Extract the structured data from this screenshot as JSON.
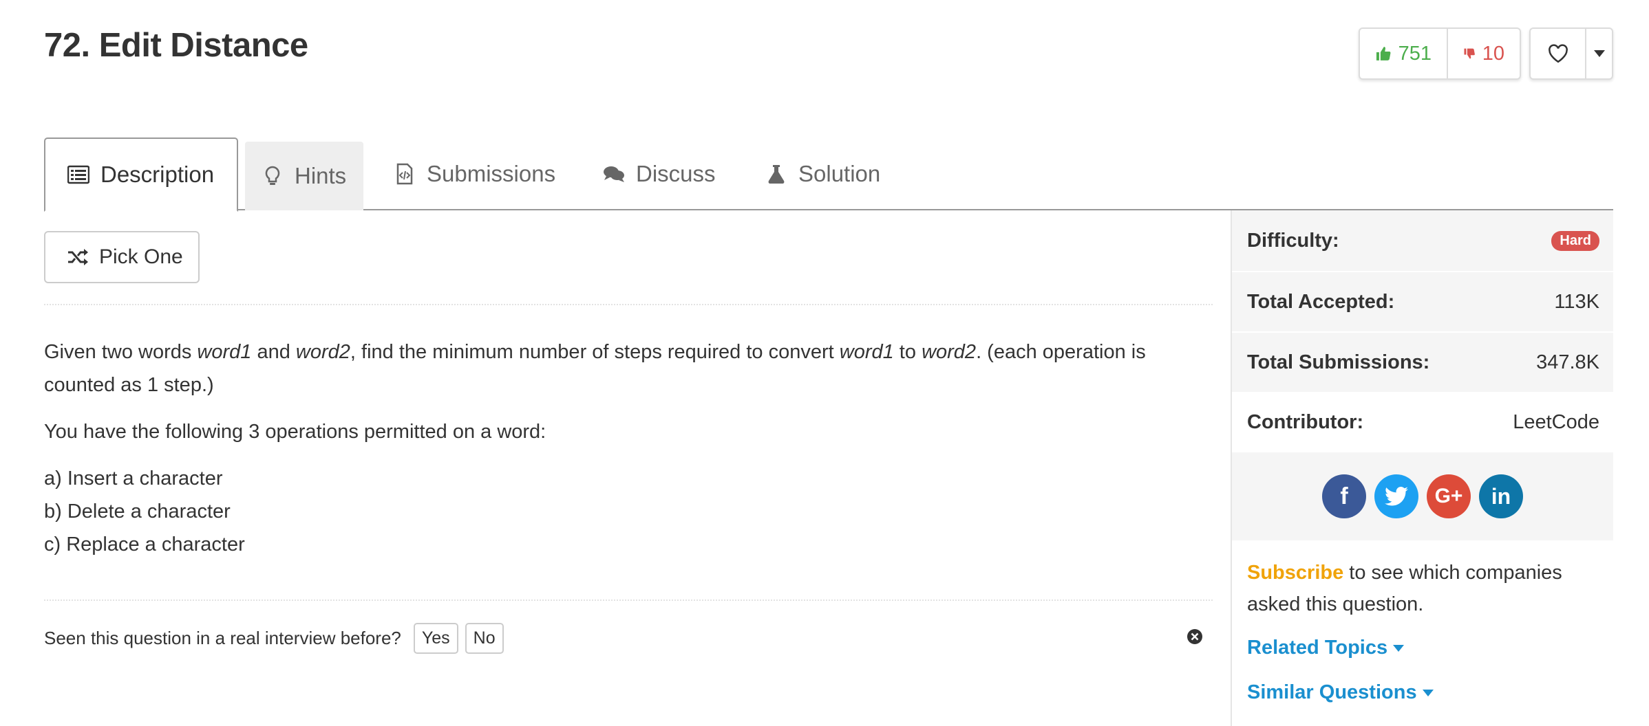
{
  "problem": {
    "title": "72. Edit Distance"
  },
  "votes": {
    "up": "751",
    "down": "10"
  },
  "tabs": [
    {
      "label": "Description"
    },
    {
      "label": "Hints"
    },
    {
      "label": "Submissions"
    },
    {
      "label": "Discuss"
    },
    {
      "label": "Solution"
    }
  ],
  "pick_one": "Pick One",
  "description": {
    "p1_a": "Given two words ",
    "word1": "word1",
    "p1_b": " and ",
    "word2": "word2",
    "p1_c": ", find the minimum number of steps required to convert ",
    "p1_d": " to ",
    "p1_e": ". (each operation is counted as 1 step.)",
    "p2": "You have the following 3 operations permitted on a word:",
    "ops": [
      "a) Insert a character",
      "b) Delete a character",
      "c) Replace a character"
    ]
  },
  "interview": {
    "question": "Seen this question in a real interview before?",
    "yes": "Yes",
    "no": "No"
  },
  "side": {
    "difficulty_label": "Difficulty:",
    "difficulty_value": "Hard",
    "accepted_label": "Total Accepted:",
    "accepted_value": "113K",
    "submissions_label": "Total Submissions:",
    "submissions_value": "347.8K",
    "contributor_label": "Contributor:",
    "contributor_value": "LeetCode",
    "social": {
      "facebook": "f",
      "twitter": "twitter-icon",
      "googleplus": "G+",
      "linkedin": "in"
    },
    "subscribe_link": "Subscribe",
    "subscribe_text": " to see which companies asked this question.",
    "related_topics": "Related Topics",
    "similar_questions": "Similar Questions"
  },
  "colors": {
    "up": "#4cae4c",
    "down": "#d9534f",
    "hard": "#d9534f",
    "link": "#1a8fcf",
    "subscribe": "#f0a30a"
  }
}
